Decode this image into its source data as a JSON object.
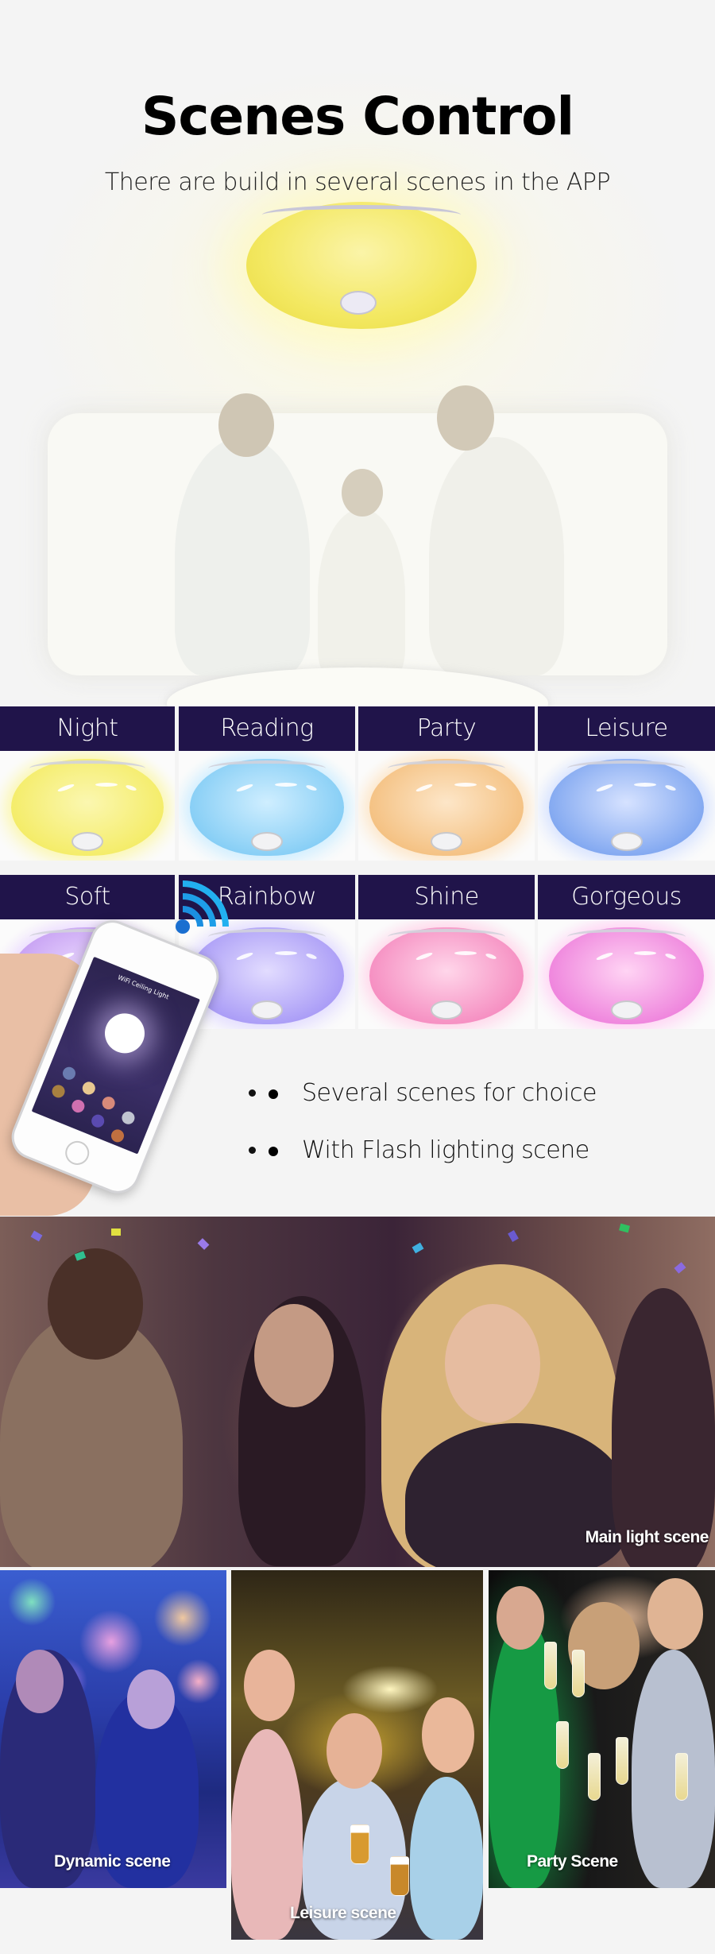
{
  "header": {
    "title": "Scenes Control",
    "subtitle": "There are build in several scenes in the APP"
  },
  "scenes": [
    {
      "label": "Night",
      "color": "#f4ec66",
      "glow": "#fbf7b0"
    },
    {
      "label": "Reading",
      "color": "#84cdf5",
      "glow": "#cfeeff"
    },
    {
      "label": "Party",
      "color": "#f4c080",
      "glow": "#fde6c8"
    },
    {
      "label": "Leisure",
      "color": "#7fa6f0",
      "glow": "#d6e2ff"
    },
    {
      "label": "Soft",
      "color": "#c49cf2",
      "glow": "#ecdcff"
    },
    {
      "label": "Rainbow",
      "color": "#a89af6",
      "glow": "#e2dcff"
    },
    {
      "label": "Shine",
      "color": "#f58cc0",
      "glow": "#ffd6ea"
    },
    {
      "label": "Gorgeous",
      "color": "#ee82dc",
      "glow": "#ffd4f4"
    }
  ],
  "phone": {
    "app_title": "WiFi Ceiling Light",
    "icon": "wifi-icon"
  },
  "features": [
    "Several scenes for choice",
    "With Flash lighting scene"
  ],
  "photos": {
    "main": "Main light scene",
    "dynamic": "Dynamic scene",
    "leisure": "Leisure scene",
    "party": "Party Scene"
  },
  "colors": {
    "label_bg": "#20144a",
    "page_bg": "#f4f4f4"
  }
}
